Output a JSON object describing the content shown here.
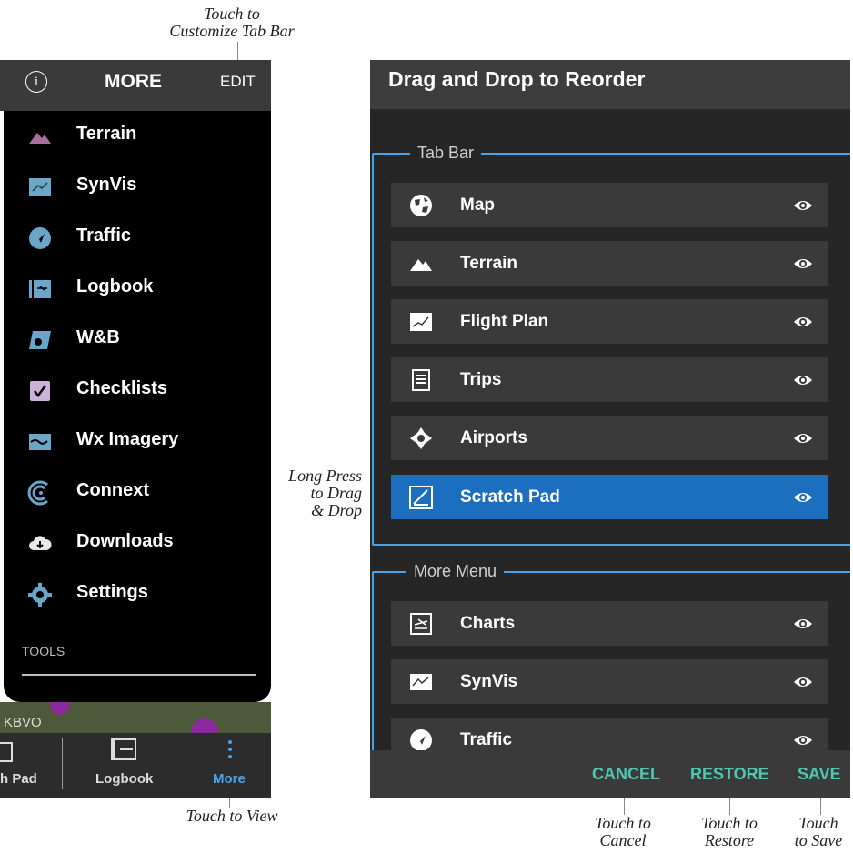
{
  "annotations": {
    "customize_line1": "Touch to",
    "customize_line2": "Customize Tab Bar",
    "drag_line1": "Long Press",
    "drag_line2": "to Drag",
    "drag_line3": "& Drop",
    "view": "Touch to View",
    "cancel_line1": "Touch to",
    "cancel_line2": "Cancel",
    "restore_line1": "Touch to",
    "restore_line2": "Restore",
    "save_line1": "Touch",
    "save_line2": "to Save"
  },
  "left": {
    "header": {
      "info_icon": "info-icon",
      "title": "MORE",
      "edit": "EDIT"
    },
    "menu": [
      {
        "label": "Terrain",
        "icon": "terrain-icon"
      },
      {
        "label": "SynVis",
        "icon": "synvis-icon"
      },
      {
        "label": "Traffic",
        "icon": "traffic-icon"
      },
      {
        "label": "Logbook",
        "icon": "logbook-icon"
      },
      {
        "label": "W&B",
        "icon": "weight-balance-icon"
      },
      {
        "label": "Checklists",
        "icon": "checklist-icon"
      },
      {
        "label": "Wx Imagery",
        "icon": "wx-imagery-icon"
      },
      {
        "label": "Connext",
        "icon": "connext-icon"
      },
      {
        "label": "Downloads",
        "icon": "cloud-download-icon"
      },
      {
        "label": "Settings",
        "icon": "gear-icon"
      }
    ],
    "tools_label": "TOOLS",
    "map_text": "KBVO",
    "tabbar": {
      "tab1": "h Pad",
      "tab2": "Logbook",
      "tab3": "More"
    },
    "colors": {
      "accent": "#4aa3e8",
      "menu_bg": "#000000"
    }
  },
  "right": {
    "title": "Drag and Drop to Reorder",
    "tab_bar_label": "Tab Bar",
    "tab_bar_items": [
      {
        "label": "Map",
        "icon": "globe-icon"
      },
      {
        "label": "Terrain",
        "icon": "terrain-icon"
      },
      {
        "label": "Flight Plan",
        "icon": "flight-plan-icon"
      },
      {
        "label": "Trips",
        "icon": "trips-icon"
      },
      {
        "label": "Airports",
        "icon": "airport-icon"
      },
      {
        "label": "Scratch Pad",
        "icon": "scratch-pad-icon",
        "selected": true
      }
    ],
    "more_menu_label": "More Menu",
    "more_menu_items": [
      {
        "label": "Charts",
        "icon": "charts-icon"
      },
      {
        "label": "SynVis",
        "icon": "synvis-icon"
      },
      {
        "label": "Traffic",
        "icon": "traffic-icon"
      }
    ],
    "footer": {
      "cancel": "CANCEL",
      "restore": "RESTORE",
      "save": "SAVE"
    },
    "colors": {
      "selected_row": "#1b6fbe",
      "footer_text": "#4ec8b3",
      "group_border": "#4aa3e8"
    }
  }
}
